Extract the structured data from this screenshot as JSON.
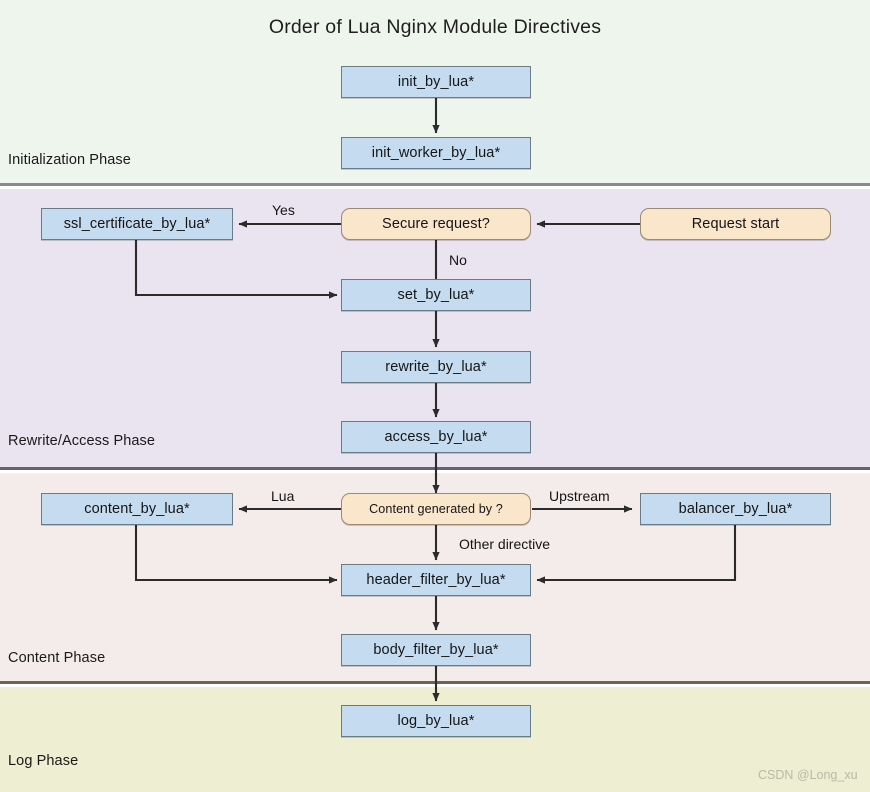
{
  "title": "Order of Lua Nginx Module Directives",
  "watermark": "CSDN @Long_xu",
  "colors": {
    "directive_fill": "#c5dcf0",
    "decision_fill": "#fae6cb",
    "band_init": "#eef5ec",
    "band_rewrite": "#eae3f0",
    "band_content": "#f4ecea",
    "band_log": "#eeeed2"
  },
  "phases": [
    {
      "label": "Initialization Phase"
    },
    {
      "label": "Rewrite/Access Phase"
    },
    {
      "label": "Content Phase"
    },
    {
      "label": "Log Phase"
    }
  ],
  "nodes": [
    {
      "id": "init_by_lua",
      "label": "init_by_lua*",
      "shape": "rect"
    },
    {
      "id": "init_worker_by_lua",
      "label": "init_worker_by_lua*",
      "shape": "rect"
    },
    {
      "id": "request_start",
      "label": "Request start",
      "shape": "round"
    },
    {
      "id": "secure_request",
      "label": "Secure request?",
      "shape": "round"
    },
    {
      "id": "ssl_certificate",
      "label": "ssl_certificate_by_lua*",
      "shape": "rect"
    },
    {
      "id": "set_by_lua",
      "label": "set_by_lua*",
      "shape": "rect"
    },
    {
      "id": "rewrite_by_lua",
      "label": "rewrite_by_lua*",
      "shape": "rect"
    },
    {
      "id": "access_by_lua",
      "label": "access_by_lua*",
      "shape": "rect"
    },
    {
      "id": "content_generated",
      "label": "Content generated by ?",
      "shape": "round"
    },
    {
      "id": "content_by_lua",
      "label": "content_by_lua*",
      "shape": "rect"
    },
    {
      "id": "balancer_by_lua",
      "label": "balancer_by_lua*",
      "shape": "rect"
    },
    {
      "id": "header_filter",
      "label": "header_filter_by_lua*",
      "shape": "rect"
    },
    {
      "id": "body_filter",
      "label": "body_filter_by_lua*",
      "shape": "rect"
    },
    {
      "id": "log_by_lua",
      "label": "log_by_lua*",
      "shape": "rect"
    }
  ],
  "edge_labels": [
    {
      "id": "yes",
      "label": "Yes"
    },
    {
      "id": "no",
      "label": "No"
    },
    {
      "id": "lua",
      "label": "Lua"
    },
    {
      "id": "upstream",
      "label": "Upstream"
    },
    {
      "id": "other_directive",
      "label": "Other directive"
    }
  ],
  "chart_data": {
    "type": "flowchart",
    "title": "Order of Lua Nginx Module Directives",
    "lanes": [
      "Initialization Phase",
      "Rewrite/Access Phase",
      "Content Phase",
      "Log Phase"
    ],
    "edges": [
      {
        "from": "init_by_lua",
        "to": "init_worker_by_lua",
        "label": ""
      },
      {
        "from": "request_start",
        "to": "secure_request",
        "label": ""
      },
      {
        "from": "secure_request",
        "to": "ssl_certificate",
        "label": "Yes"
      },
      {
        "from": "secure_request",
        "to": "set_by_lua",
        "label": "No"
      },
      {
        "from": "ssl_certificate",
        "to": "set_by_lua",
        "label": ""
      },
      {
        "from": "set_by_lua",
        "to": "rewrite_by_lua",
        "label": ""
      },
      {
        "from": "rewrite_by_lua",
        "to": "access_by_lua",
        "label": ""
      },
      {
        "from": "access_by_lua",
        "to": "content_generated",
        "label": ""
      },
      {
        "from": "content_generated",
        "to": "content_by_lua",
        "label": "Lua"
      },
      {
        "from": "content_generated",
        "to": "balancer_by_lua",
        "label": "Upstream"
      },
      {
        "from": "content_generated",
        "to": "header_filter",
        "label": "Other directive"
      },
      {
        "from": "content_by_lua",
        "to": "header_filter",
        "label": ""
      },
      {
        "from": "balancer_by_lua",
        "to": "header_filter",
        "label": ""
      },
      {
        "from": "header_filter",
        "to": "body_filter",
        "label": ""
      },
      {
        "from": "body_filter",
        "to": "log_by_lua",
        "label": ""
      }
    ]
  }
}
